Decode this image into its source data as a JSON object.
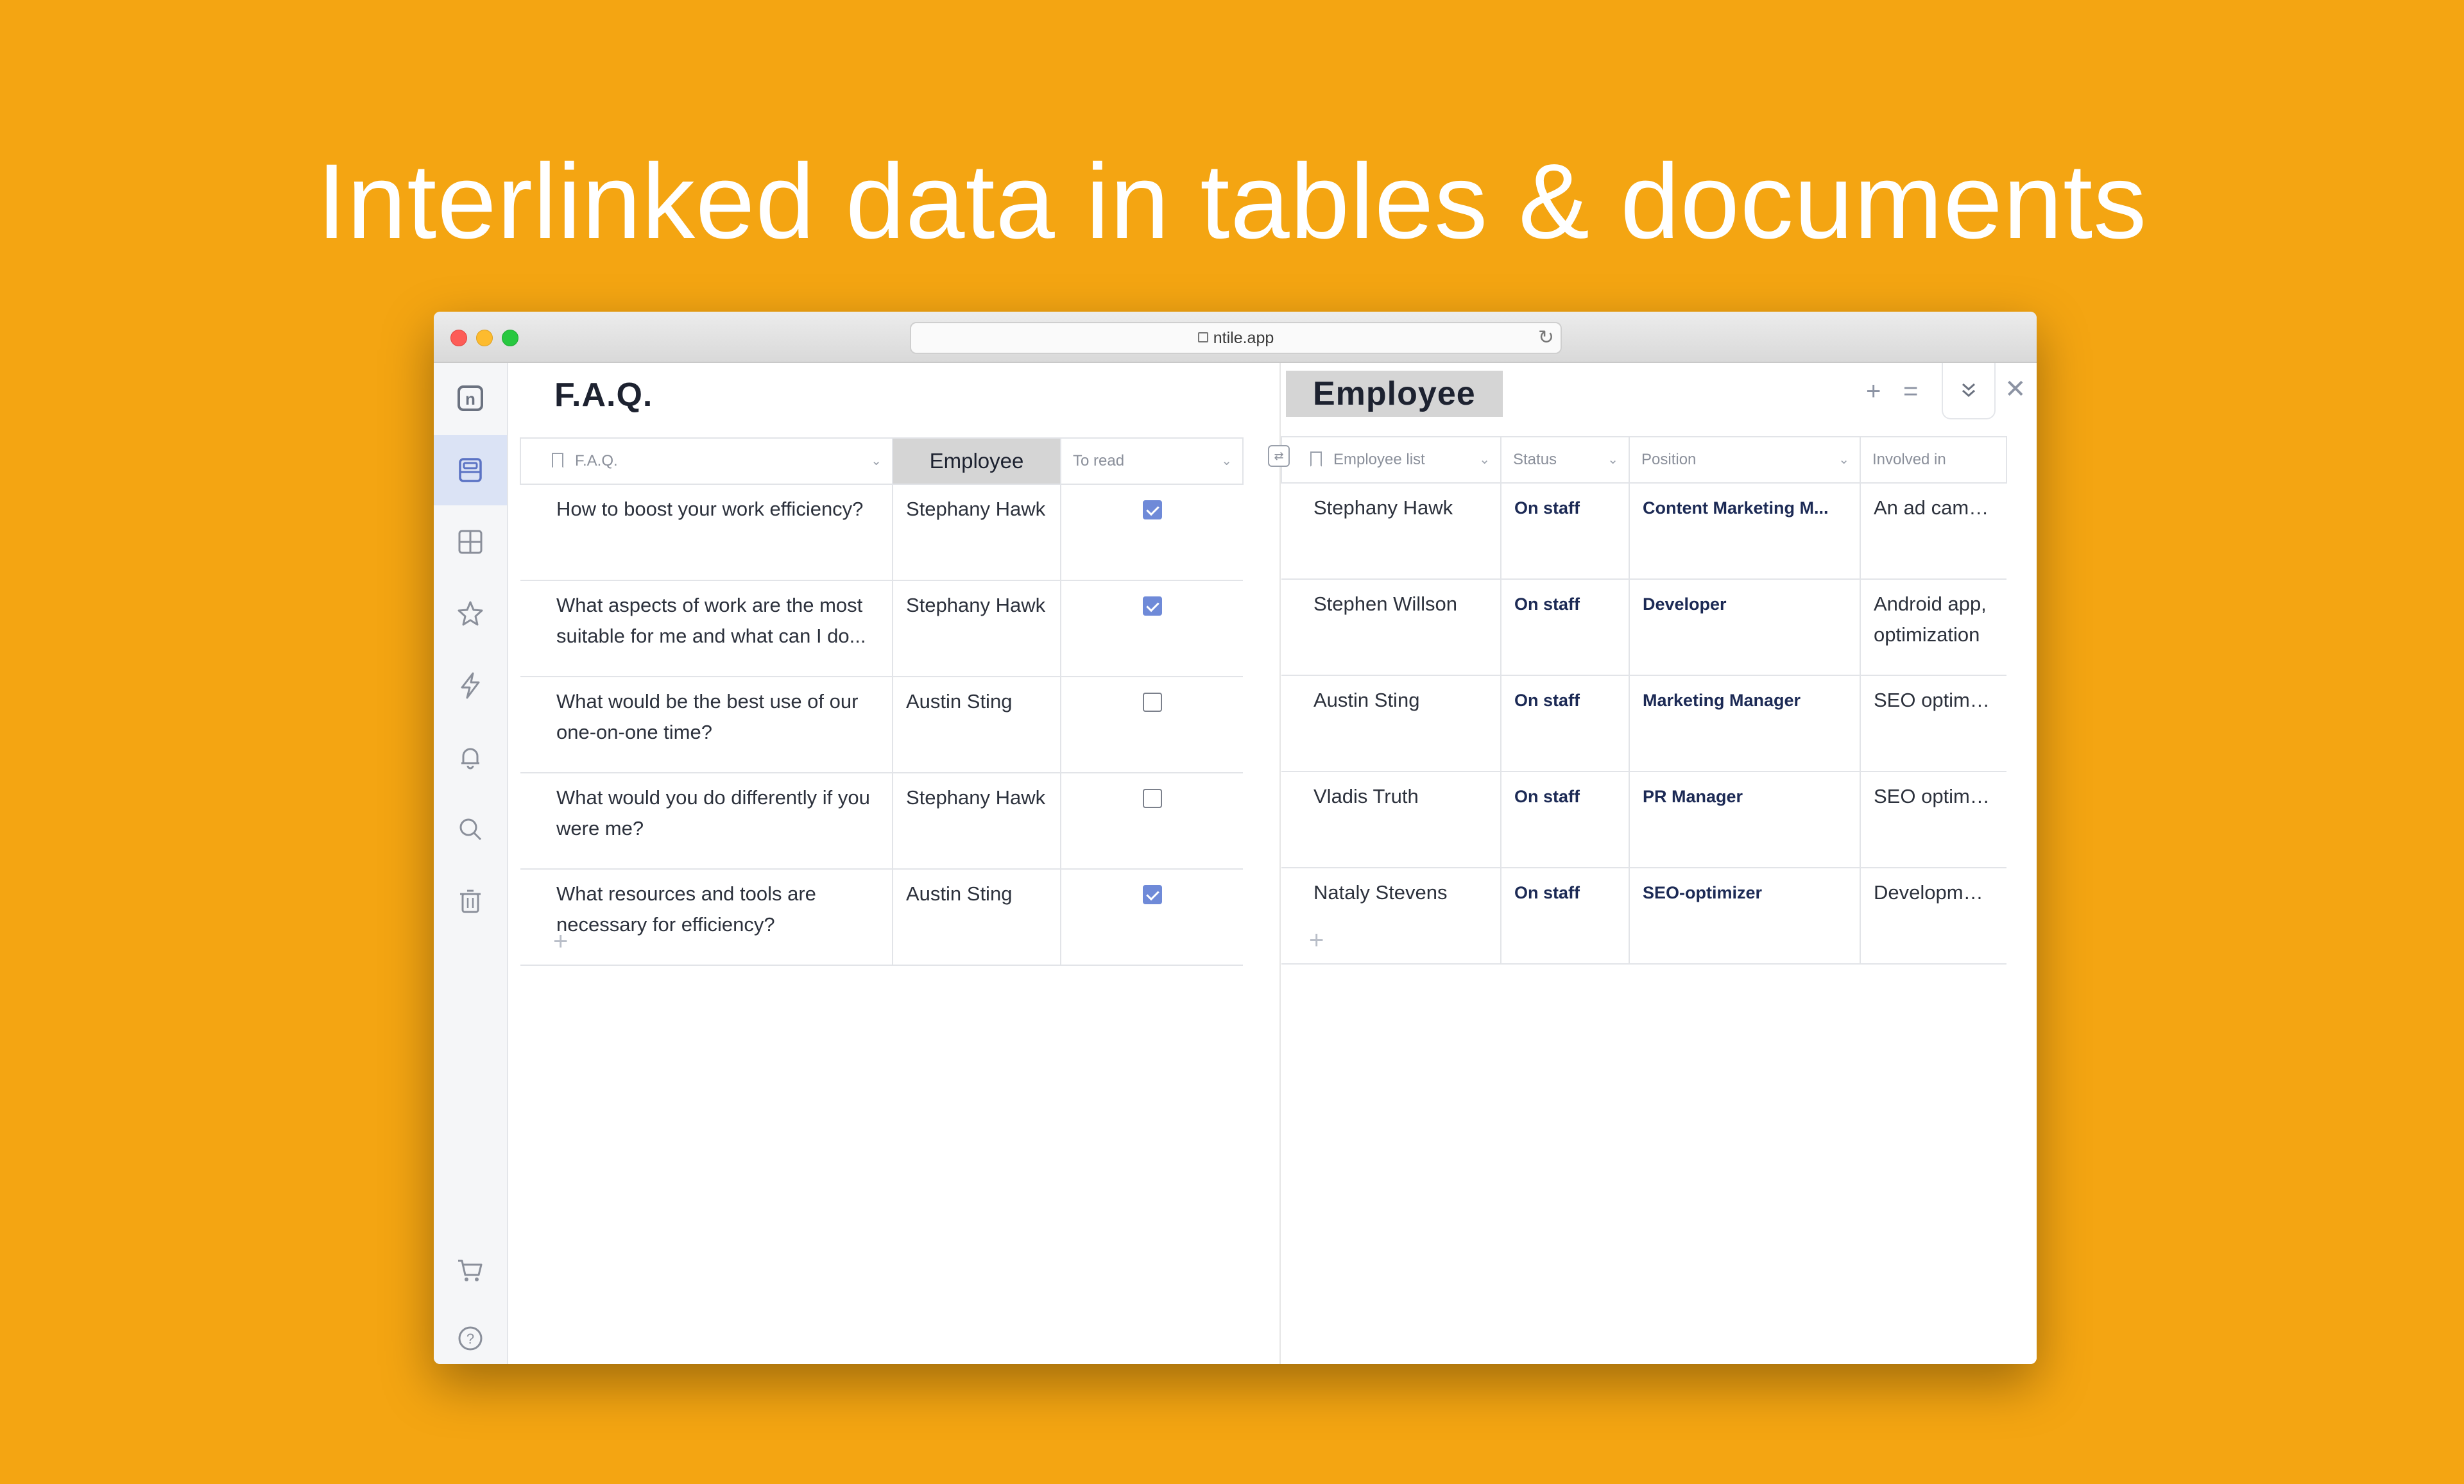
{
  "headline": "Interlinked data in tables & documents",
  "browser": {
    "url": "ntile.app"
  },
  "sidebar": {
    "logo": "n",
    "items": [
      "database-icon",
      "grid-icon",
      "star-icon",
      "bolt-icon",
      "bell-icon",
      "search-icon",
      "trash-icon",
      "cart-icon",
      "help-icon"
    ]
  },
  "faq": {
    "title": "F.A.Q.",
    "columns": [
      "F.A.Q.",
      "Employee",
      "To read"
    ],
    "rows": [
      {
        "question": "How to boost your work efficiency?",
        "employee": "Stephany Hawk",
        "to_read": true
      },
      {
        "question": "What aspects of work are the most suitable for me and what can I do...",
        "employee": "Stephany Hawk",
        "to_read": true
      },
      {
        "question": "What would be the best use of our one-on-one time?",
        "employee": "Austin Sting",
        "to_read": false
      },
      {
        "question": "What would you do differently if you were me?",
        "employee": "Stephany Hawk",
        "to_read": false
      },
      {
        "question": "What resources and tools are necessary for efficiency?",
        "employee": "Austin Sting",
        "to_read": true
      }
    ],
    "add_symbol": "+"
  },
  "employee": {
    "title": "Employee",
    "columns": [
      "Employee list",
      "Status",
      "Position",
      "Involved in"
    ],
    "rows": [
      {
        "name": "Stephany Hawk",
        "status": "On staff",
        "position": "Content Marketing M...",
        "involved": "An ad campaign"
      },
      {
        "name": "Stephen Willson",
        "status": "On staff",
        "position": "Developer",
        "involved": "Android app, optimization"
      },
      {
        "name": "Austin Sting",
        "status": "On staff",
        "position": "Marketing Manager",
        "involved": "SEO optimization"
      },
      {
        "name": "Vladis Truth",
        "status": "On staff",
        "position": "PR Manager",
        "involved": "SEO optimization"
      },
      {
        "name": "Nataly Stevens",
        "status": "On staff",
        "position": "SEO-optimizer",
        "involved": "Development of"
      }
    ],
    "add_symbol": "+"
  },
  "toolbar": {
    "add": "+",
    "menu": "=",
    "collapse": "⌄",
    "close": "✕"
  }
}
